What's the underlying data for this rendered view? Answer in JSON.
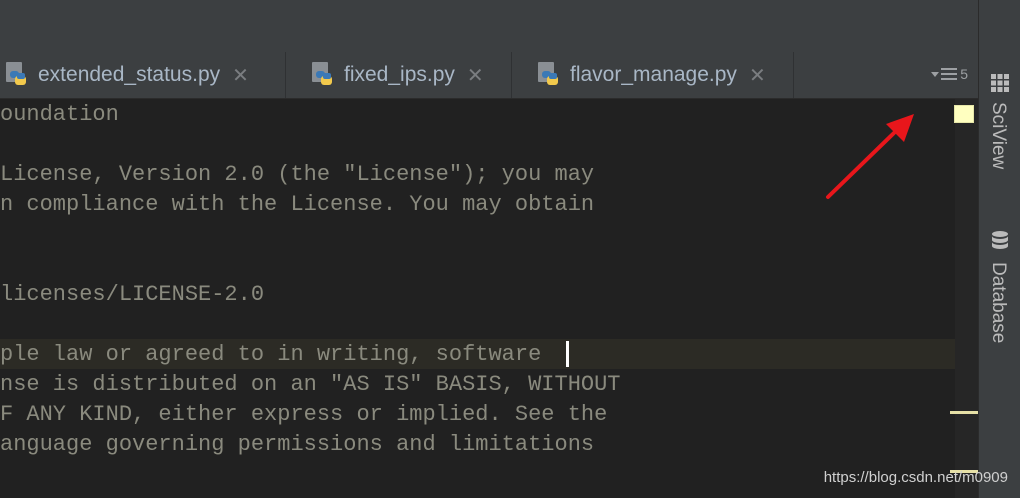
{
  "tabs": [
    {
      "label": "extended_status.py",
      "close": "✕"
    },
    {
      "label": "fixed_ips.py",
      "close": "✕"
    },
    {
      "label": "flavor_manage.py",
      "close": "✕"
    }
  ],
  "tab_menu": {
    "count": "5"
  },
  "editor": {
    "lines": [
      "oundation",
      "",
      "License, Version 2.0 (the \"License\"); you may",
      "n compliance with the License. You may obtain",
      "",
      "",
      "licenses/LICENSE-2.0",
      "",
      "ple law or agreed to in writing, software",
      "nse is distributed on an \"AS IS\" BASIS, WITHOUT",
      "F ANY KIND, either express or implied. See the",
      "anguage governing permissions and limitations"
    ]
  },
  "right_panel": {
    "sciview_label": "SciView",
    "database_label": "Database"
  },
  "watermark": "https://blog.csdn.net/m0909",
  "colors": {
    "accent_arrow": "#e8161b",
    "tab_text": "#a9b7c6",
    "code_text": "#8a8a7e"
  }
}
